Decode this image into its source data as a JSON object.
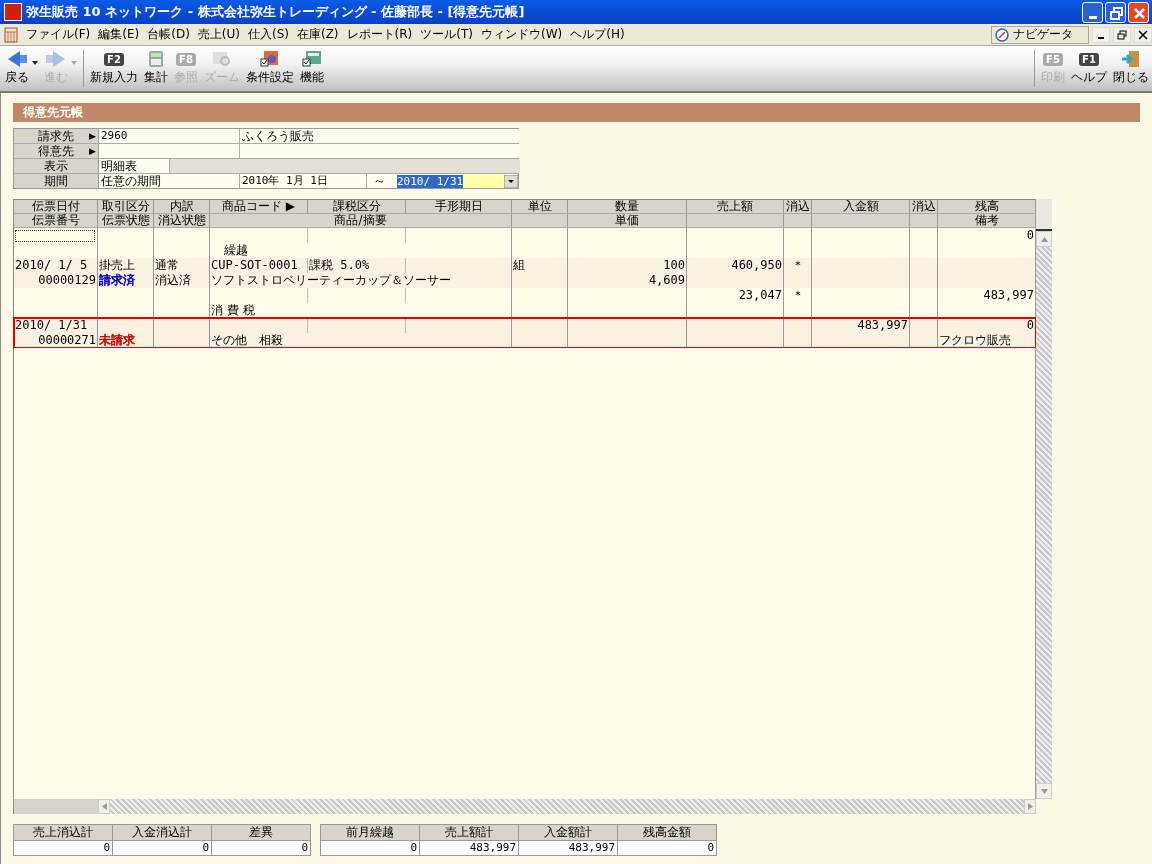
{
  "window": {
    "title": "弥生販売 10 ネットワーク - 株式会社弥生トレーディング - 佐藤部長 - [得意先元帳]"
  },
  "menu": [
    "ファイル(F)",
    "編集(E)",
    "台帳(D)",
    "売上(U)",
    "仕入(S)",
    "在庫(Z)",
    "レポート(R)",
    "ツール(T)",
    "ウィンドウ(W)",
    "ヘルプ(H)"
  ],
  "navigator": {
    "label": "ナビゲータ"
  },
  "toolbar_left": [
    {
      "kind": "back",
      "label": "戻る",
      "dropdown": true,
      "disabled": false
    },
    {
      "kind": "forward",
      "label": "進む",
      "dropdown": true,
      "disabled": true
    },
    {
      "kind": "key",
      "key": "F2",
      "label": "新規入力",
      "dropdown": false,
      "disabled": false
    },
    {
      "kind": "calculator",
      "label": "集計",
      "dropdown": false,
      "disabled": false
    },
    {
      "kind": "key",
      "key": "F8",
      "label": "参照",
      "dropdown": false,
      "disabled": true
    },
    {
      "kind": "zoom",
      "label": "ズーム",
      "dropdown": false,
      "disabled": true
    },
    {
      "kind": "conditions",
      "label": "条件設定",
      "dropdown": false,
      "disabled": false
    },
    {
      "kind": "function",
      "label": "機能",
      "dropdown": false,
      "disabled": false
    }
  ],
  "toolbar_right": [
    {
      "kind": "key",
      "key": "F5",
      "label": "印刷",
      "dropdown": false,
      "disabled": true
    },
    {
      "kind": "key",
      "key": "F1",
      "label": "ヘルプ",
      "dropdown": false,
      "disabled": false
    },
    {
      "kind": "exit",
      "label": "閉じる",
      "dropdown": false,
      "disabled": false
    }
  ],
  "section_title": "得意先元帳",
  "form": {
    "billing": {
      "label": "請求先",
      "marker": "▶",
      "code": "2960",
      "name": "ふくろう販売"
    },
    "customer": {
      "label": "得意先",
      "marker": "▶"
    },
    "display": {
      "label": "表示",
      "value": "明細表"
    },
    "period": {
      "label": "期間",
      "value": "任意の期間",
      "from": "2010年 1月 1日",
      "separator": "～",
      "to": "2010/ 1/31"
    }
  },
  "table": {
    "columns_top": [
      "伝票日付",
      "取引区分",
      "内訳",
      "商品コード ▶",
      "課税区分",
      "手形期日",
      "単位",
      "数量",
      "売上額",
      "消込",
      "入金額",
      "消込",
      "残高"
    ],
    "columns_bottom": [
      "伝票番号",
      "伝票状態",
      "消込状態",
      "商品/摘要",
      "単価",
      "備考"
    ],
    "rows": [
      {
        "kind": "carry",
        "selected": false,
        "focused": true,
        "description": "繰越",
        "balance": "0"
      },
      {
        "kind": "sale",
        "selected": false,
        "focused": false,
        "date": "2010/ 1/ 5",
        "slip_no": "00000129",
        "type": "掛売上",
        "status": {
          "text": "請求済",
          "color": "#0000c0"
        },
        "breakdown": "通常",
        "clear_status": "消込済",
        "code": "CUP-SOT-0001",
        "tax": "課税 5.0%",
        "description": "ソフトストロベリーティーカップ＆ソーサー",
        "unit": "組",
        "qty": "100",
        "price": "4,609",
        "sales": "460,950",
        "sales_cleared": "＊"
      },
      {
        "kind": "tax",
        "selected": false,
        "focused": false,
        "description": "消 費 税",
        "sales": "23,047",
        "sales_cleared": "＊",
        "balance": "483,997"
      },
      {
        "kind": "payment",
        "selected": true,
        "focused": false,
        "date": "2010/ 1/31",
        "slip_no": "00000271",
        "status": {
          "text": "未請求",
          "color": "#d00000"
        },
        "description": "その他　相殺",
        "payment": "483,997",
        "balance": "0",
        "note": "フクロウ販売"
      }
    ]
  },
  "totals_left": [
    {
      "label": "売上消込計",
      "value": "0"
    },
    {
      "label": "入金消込計",
      "value": "0"
    },
    {
      "label": "差異",
      "value": "0"
    }
  ],
  "totals_right": [
    {
      "label": "前月繰越",
      "value": "0"
    },
    {
      "label": "売上額計",
      "value": "483,997"
    },
    {
      "label": "入金額計",
      "value": "483,997"
    },
    {
      "label": "残高金額",
      "value": "0"
    }
  ]
}
